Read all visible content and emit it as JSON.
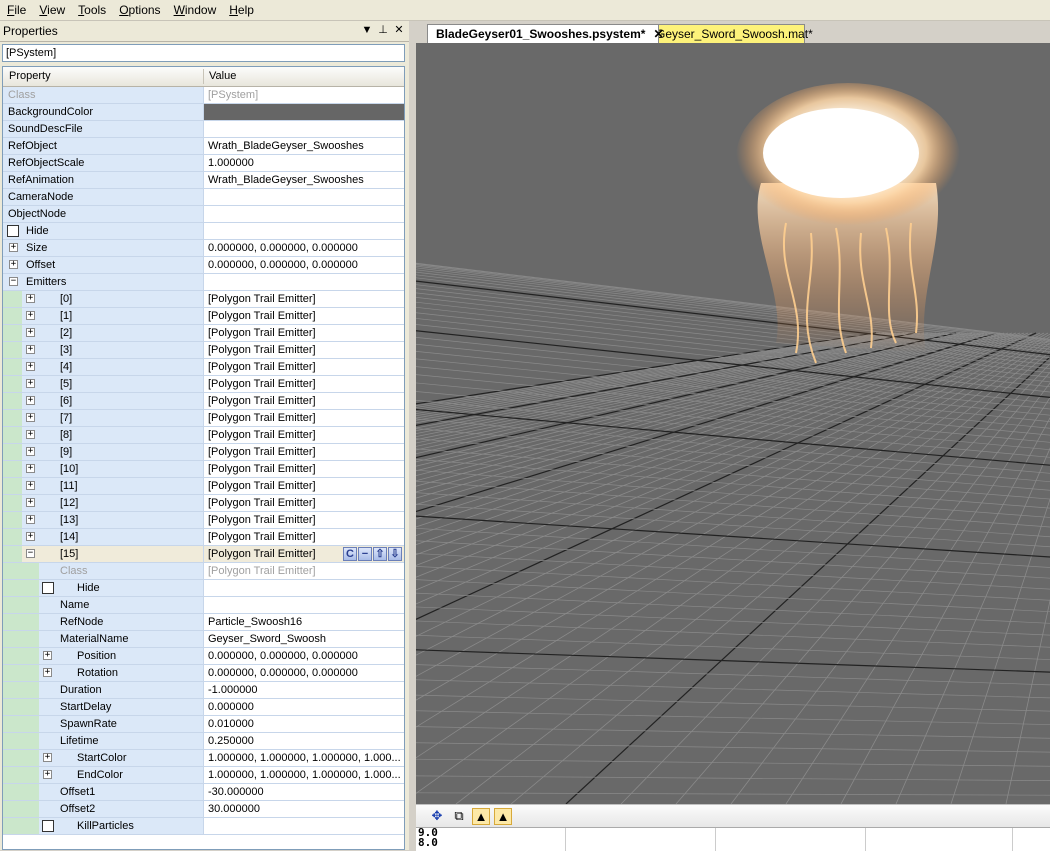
{
  "menu": [
    "File",
    "View",
    "Tools",
    "Options",
    "Window",
    "Help"
  ],
  "panel": {
    "title": "Properties",
    "object_name": "[PSystem]",
    "header": {
      "property": "Property",
      "value": "Value"
    }
  },
  "props": {
    "class": {
      "name": "Class",
      "value": "[PSystem]"
    },
    "background_color": {
      "name": "BackgroundColor",
      "color": "#666666"
    },
    "sound_desc_file": {
      "name": "SoundDescFile",
      "value": ""
    },
    "ref_object": {
      "name": "RefObject",
      "value": "Wrath_BladeGeyser_Swooshes"
    },
    "ref_object_scale": {
      "name": "RefObjectScale",
      "value": "1.000000"
    },
    "ref_animation": {
      "name": "RefAnimation",
      "value": "Wrath_BladeGeyser_Swooshes"
    },
    "camera_node": {
      "name": "CameraNode",
      "value": ""
    },
    "object_node": {
      "name": "ObjectNode",
      "value": ""
    },
    "hide": {
      "name": "Hide"
    },
    "size": {
      "name": "Size",
      "value": "0.000000, 0.000000, 0.000000"
    },
    "offset": {
      "name": "Offset",
      "value": "0.000000, 0.000000, 0.000000"
    },
    "emitters": {
      "name": "Emitters",
      "value": ""
    }
  },
  "emitters": [
    {
      "name": "[0]",
      "value": "[Polygon Trail Emitter]"
    },
    {
      "name": "[1]",
      "value": "[Polygon Trail Emitter]"
    },
    {
      "name": "[2]",
      "value": "[Polygon Trail Emitter]"
    },
    {
      "name": "[3]",
      "value": "[Polygon Trail Emitter]"
    },
    {
      "name": "[4]",
      "value": "[Polygon Trail Emitter]"
    },
    {
      "name": "[5]",
      "value": "[Polygon Trail Emitter]"
    },
    {
      "name": "[6]",
      "value": "[Polygon Trail Emitter]"
    },
    {
      "name": "[7]",
      "value": "[Polygon Trail Emitter]"
    },
    {
      "name": "[8]",
      "value": "[Polygon Trail Emitter]"
    },
    {
      "name": "[9]",
      "value": "[Polygon Trail Emitter]"
    },
    {
      "name": "[10]",
      "value": "[Polygon Trail Emitter]"
    },
    {
      "name": "[11]",
      "value": "[Polygon Trail Emitter]"
    },
    {
      "name": "[12]",
      "value": "[Polygon Trail Emitter]"
    },
    {
      "name": "[13]",
      "value": "[Polygon Trail Emitter]"
    },
    {
      "name": "[14]",
      "value": "[Polygon Trail Emitter]"
    }
  ],
  "selected": {
    "name": "[15]",
    "value": "[Polygon Trail Emitter]",
    "buttons": {
      "copy": "C",
      "remove": "−",
      "up": "⇧",
      "down": "⇩"
    },
    "class": {
      "name": "Class",
      "value": "[Polygon Trail Emitter]"
    },
    "hide": {
      "name": "Hide"
    },
    "name_prop": {
      "name": "Name",
      "value": ""
    },
    "ref_node": {
      "name": "RefNode",
      "value": "Particle_Swoosh16"
    },
    "material_name": {
      "name": "MaterialName",
      "value": "Geyser_Sword_Swoosh"
    },
    "position": {
      "name": "Position",
      "value": "0.000000, 0.000000, 0.000000"
    },
    "rotation": {
      "name": "Rotation",
      "value": "0.000000, 0.000000, 0.000000"
    },
    "duration": {
      "name": "Duration",
      "value": "-1.000000"
    },
    "start_delay": {
      "name": "StartDelay",
      "value": "0.000000"
    },
    "spawn_rate": {
      "name": "SpawnRate",
      "value": "0.010000"
    },
    "lifetime": {
      "name": "Lifetime",
      "value": "0.250000"
    },
    "start_color": {
      "name": "StartColor",
      "value": "1.000000, 1.000000, 1.000000, 1.000..."
    },
    "end_color": {
      "name": "EndColor",
      "value": "1.000000, 1.000000, 1.000000, 1.000..."
    },
    "offset1": {
      "name": "Offset1",
      "value": "-30.000000"
    },
    "offset2": {
      "name": "Offset2",
      "value": "30.000000"
    },
    "kill_particles": {
      "name": "KillParticles"
    }
  },
  "tabs": {
    "active": "BladeGeyser01_Swooshes.psystem*",
    "other": "Geyser_Sword_Swoosh.mat*"
  },
  "log_lines": [
    "9.0",
    "8.0"
  ],
  "colors": {
    "viewport": "#696969",
    "tab_other": "#fdf27a",
    "prop_name_bg": "#dbe8f8",
    "indent_green": "#cbe7cb"
  }
}
